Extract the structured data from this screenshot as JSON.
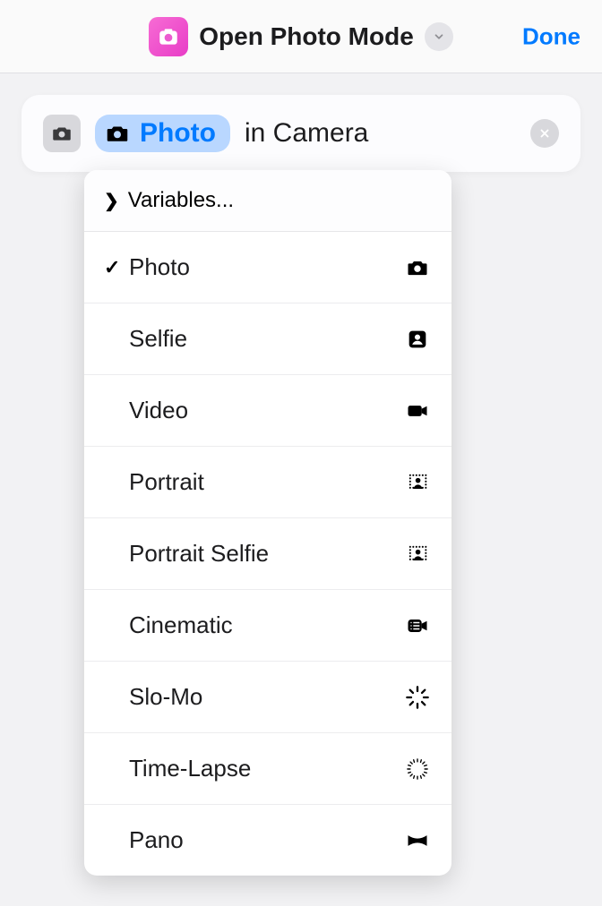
{
  "header": {
    "title": "Open Photo Mode",
    "done_label": "Done"
  },
  "action": {
    "token_label": "Photo",
    "suffix": "in Camera"
  },
  "dropdown": {
    "variables_label": "Variables...",
    "items": [
      {
        "label": "Photo",
        "checked": true,
        "icon": "camera"
      },
      {
        "label": "Selfie",
        "checked": false,
        "icon": "selfie"
      },
      {
        "label": "Video",
        "checked": false,
        "icon": "video"
      },
      {
        "label": "Portrait",
        "checked": false,
        "icon": "portrait"
      },
      {
        "label": "Portrait Selfie",
        "checked": false,
        "icon": "portrait"
      },
      {
        "label": "Cinematic",
        "checked": false,
        "icon": "cinematic"
      },
      {
        "label": "Slo-Mo",
        "checked": false,
        "icon": "slomo"
      },
      {
        "label": "Time-Lapse",
        "checked": false,
        "icon": "timelapse"
      },
      {
        "label": "Pano",
        "checked": false,
        "icon": "pano"
      }
    ]
  }
}
